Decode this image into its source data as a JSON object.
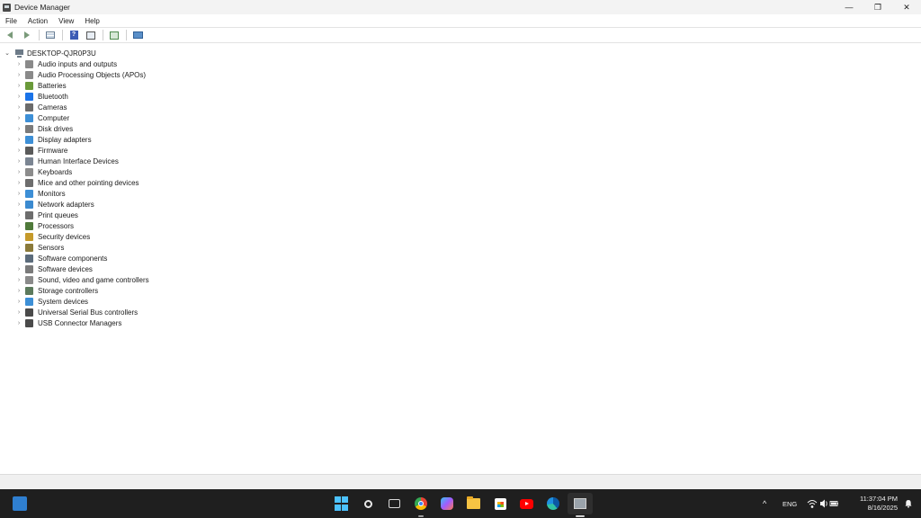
{
  "window": {
    "title": "Device Manager",
    "controls": {
      "minimize": "—",
      "restore": "❐",
      "close": "✕"
    }
  },
  "menu": [
    "File",
    "Action",
    "View",
    "Help"
  ],
  "toolbar": {
    "icons": [
      "back-arrow-icon",
      "forward-arrow-icon",
      "show-hide-console-tree-icon",
      "help-icon",
      "properties-icon",
      "scan-hardware-changes-icon",
      "monitor-icon"
    ]
  },
  "tree": {
    "root": "DESKTOP-QJR0P3U",
    "root_chevron": "⌄",
    "child_chevron": "›",
    "items": [
      {
        "label": "Audio inputs and outputs",
        "icon": "speaker-icon",
        "color": "#8a8a8a"
      },
      {
        "label": "Audio Processing Objects (APOs)",
        "icon": "speaker-icon",
        "color": "#8a8a8a"
      },
      {
        "label": "Batteries",
        "icon": "battery-icon",
        "color": "#6a9a3a"
      },
      {
        "label": "Bluetooth",
        "icon": "bluetooth-icon",
        "color": "#1a73e8"
      },
      {
        "label": "Cameras",
        "icon": "camera-icon",
        "color": "#6b6b6b"
      },
      {
        "label": "Computer",
        "icon": "computer-icon",
        "color": "#3d8fd6"
      },
      {
        "label": "Disk drives",
        "icon": "disk-drive-icon",
        "color": "#7b7b7b"
      },
      {
        "label": "Display adapters",
        "icon": "display-adapter-icon",
        "color": "#3d8fd6"
      },
      {
        "label": "Firmware",
        "icon": "firmware-icon",
        "color": "#5a5a5a"
      },
      {
        "label": "Human Interface Devices",
        "icon": "hid-icon",
        "color": "#7b8592"
      },
      {
        "label": "Keyboards",
        "icon": "keyboard-icon",
        "color": "#8c8c8c"
      },
      {
        "label": "Mice and other pointing devices",
        "icon": "mouse-icon",
        "color": "#6d6d6d"
      },
      {
        "label": "Monitors",
        "icon": "monitor-icon",
        "color": "#3d8fd6"
      },
      {
        "label": "Network adapters",
        "icon": "network-adapter-icon",
        "color": "#3b8ad0"
      },
      {
        "label": "Print queues",
        "icon": "printer-icon",
        "color": "#6d6d6d"
      },
      {
        "label": "Processors",
        "icon": "processor-icon",
        "color": "#4f7a3a"
      },
      {
        "label": "Security devices",
        "icon": "security-device-icon",
        "color": "#c59a2a"
      },
      {
        "label": "Sensors",
        "icon": "sensor-icon",
        "color": "#8a7a3a"
      },
      {
        "label": "Software components",
        "icon": "software-component-icon",
        "color": "#5b6b7b"
      },
      {
        "label": "Software devices",
        "icon": "software-device-icon",
        "color": "#7a7a7a"
      },
      {
        "label": "Sound, video and game controllers",
        "icon": "sound-controller-icon",
        "color": "#8a8a8a"
      },
      {
        "label": "Storage controllers",
        "icon": "storage-controller-icon",
        "color": "#5c7a5c"
      },
      {
        "label": "System devices",
        "icon": "system-device-icon",
        "color": "#3d8fd6"
      },
      {
        "label": "Universal Serial Bus controllers",
        "icon": "usb-icon",
        "color": "#4a4a4a"
      },
      {
        "label": "USB Connector Managers",
        "icon": "usb-icon",
        "color": "#4a4a4a"
      }
    ]
  },
  "taskbar": {
    "apps": [
      "widgets-icon",
      "start-icon",
      "search-icon",
      "task-view-icon",
      "chrome-icon",
      "copilot-icon",
      "file-explorer-icon",
      "microsoft-store-icon",
      "youtube-icon",
      "edge-icon",
      "device-manager-icon"
    ],
    "tray": {
      "overflow": "^",
      "language": "ENG",
      "wifi": "wifi-icon",
      "volume": "volume-icon",
      "battery": "battery-icon",
      "time": "11:37:04 PM",
      "date": "8/16/2025"
    }
  }
}
